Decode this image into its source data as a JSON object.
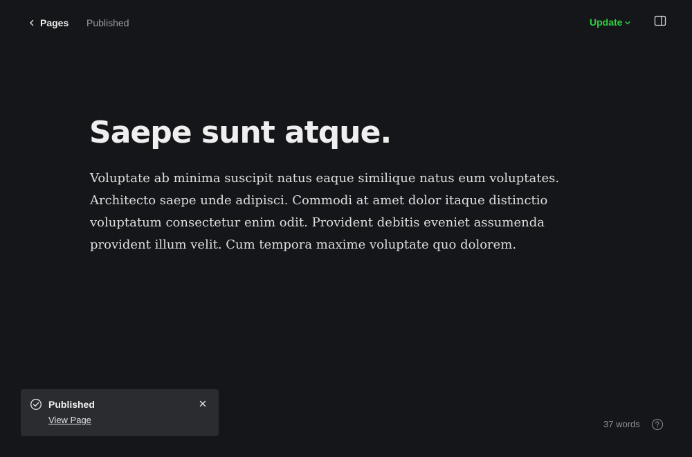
{
  "header": {
    "back_label": "Pages",
    "status": "Published",
    "update_label": "Update",
    "accent_color": "#30cf43"
  },
  "icons": {
    "back": "chevron-left-icon",
    "update_menu": "chevron-down-icon",
    "panel": "sidebar-panel-icon",
    "toast_status": "check-circle-icon",
    "toast_close": "close-icon",
    "help": "help-circle-icon"
  },
  "content": {
    "title": "Saepe sunt atque.",
    "paragraph": "Voluptate ab minima suscipit natus eaque similique natus eum voluptates. Architecto saepe unde adipisci. Commodi at amet dolor itaque distinctio voluptatum consectetur enim odit. Provident debitis eveniet assumenda provident illum velit. Cum tempora maxime voluptate quo dolorem."
  },
  "toast": {
    "title": "Published",
    "link_label": "View Page"
  },
  "footer": {
    "word_count": "37 words"
  }
}
